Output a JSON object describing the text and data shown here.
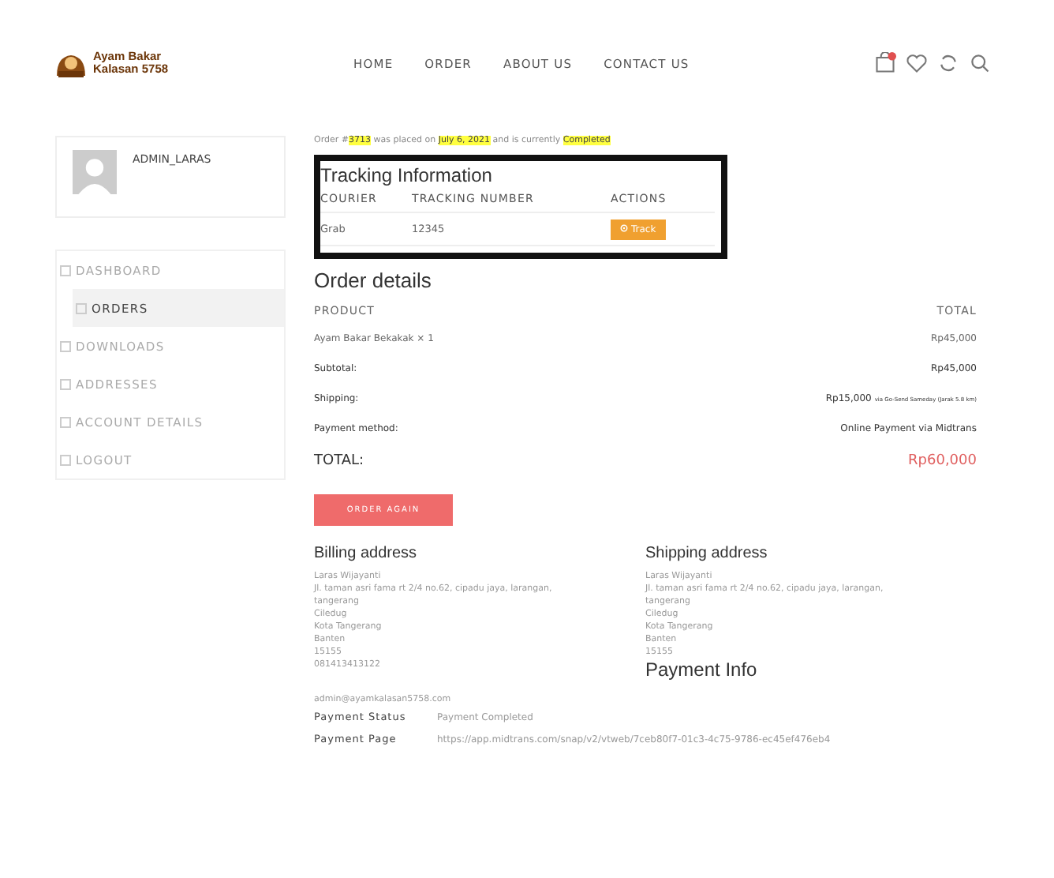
{
  "logo": {
    "line_1": "Ayam Bakar",
    "line_2": "Kalasan 5758"
  },
  "nav": [
    {
      "label": "HOME",
      "selected": false
    },
    {
      "label": "ORDER",
      "selected": false
    },
    {
      "label": "ABOUT US",
      "selected": false
    },
    {
      "label": "CONTACT US",
      "selected": false
    }
  ],
  "profile": {
    "name": "ADMIN_LARAS"
  },
  "sidebar": {
    "items": [
      {
        "label": "DASHBOARD",
        "selected": false
      },
      {
        "label": "ORDERS",
        "selected": true
      },
      {
        "label": "DOWNLOADS",
        "selected": false
      },
      {
        "label": "ADDRESSES",
        "selected": false
      },
      {
        "label": "ACCOUNT DETAILS",
        "selected": false
      },
      {
        "label": "LOGOUT",
        "selected": false
      }
    ]
  },
  "order_notice": {
    "prefix": "Order #",
    "number": "3713",
    "mid_1": " was placed on ",
    "date": "July 6, 2021",
    "mid_2": " and is currently ",
    "status": "Completed"
  },
  "tracking": {
    "title": "Tracking Information",
    "columns": [
      "COURIER",
      "TRACKING NUMBER",
      "ACTIONS"
    ],
    "rows": [
      {
        "courier": "Grab",
        "number": "12345",
        "action": "Track"
      }
    ]
  },
  "order_details": {
    "title": "Order details",
    "columns": [
      "PRODUCT",
      "TOTAL"
    ],
    "items": [
      {
        "name": "Ayam Bakar Bekakak × 1",
        "total": "Rp45,000"
      }
    ],
    "summary": [
      {
        "label": "Subtotal:",
        "value": "Rp45,000"
      },
      {
        "label": "Shipping:",
        "value": "Rp15,000",
        "note": "via Go-Send Sameday (Jarak 5.8 km)"
      },
      {
        "label": "Payment method:",
        "value": "Online Payment via Midtrans"
      }
    ],
    "total": {
      "label": "TOTAL:",
      "value": "Rp60,000"
    },
    "button": "ORDER AGAIN"
  },
  "billing": {
    "title": "Billing address",
    "lines": [
      "Laras Wijayanti",
      "Jl. taman asri fama rt 2/4 no.62, cipadu jaya, larangan,",
      "tangerang",
      "Ciledug",
      "Kota Tangerang",
      "Banten",
      "15155",
      "081413413122"
    ],
    "email": "admin@ayamkalasan5758.com"
  },
  "shipping": {
    "title": "Shipping address",
    "lines": [
      "Laras Wijayanti",
      "Jl. taman asri fama rt 2/4 no.62, cipadu jaya, larangan,",
      "tangerang",
      "Ciledug",
      "Kota Tangerang",
      "Banten",
      "15155"
    ]
  },
  "payment_info": {
    "title": "Payment Info",
    "rows": [
      {
        "label": "Payment Status",
        "value": "Payment Completed"
      },
      {
        "label": "Payment Page",
        "value": "https://app.midtrans.com/snap/v2/vtweb/7ceb80f7-01c3-4c75-9786-ec45ef476eb4"
      }
    ]
  }
}
